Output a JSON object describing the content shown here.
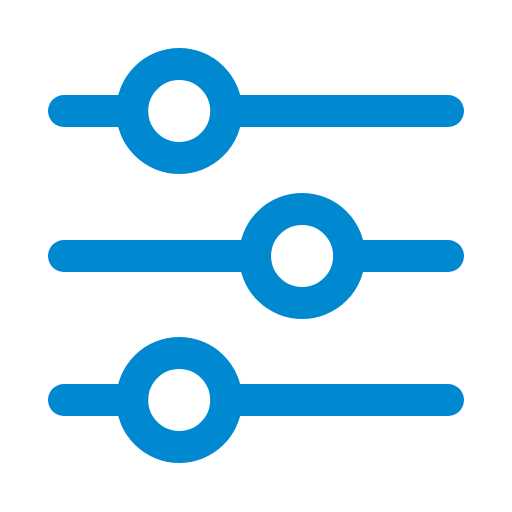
{
  "icon": {
    "name": "sliders-icon",
    "color": "#0088d1",
    "background": "#ffffff"
  },
  "sliders": [
    {
      "name": "slider-1",
      "level": 0.3
    },
    {
      "name": "slider-2",
      "level": 0.62
    },
    {
      "name": "slider-3",
      "level": 0.3
    }
  ]
}
